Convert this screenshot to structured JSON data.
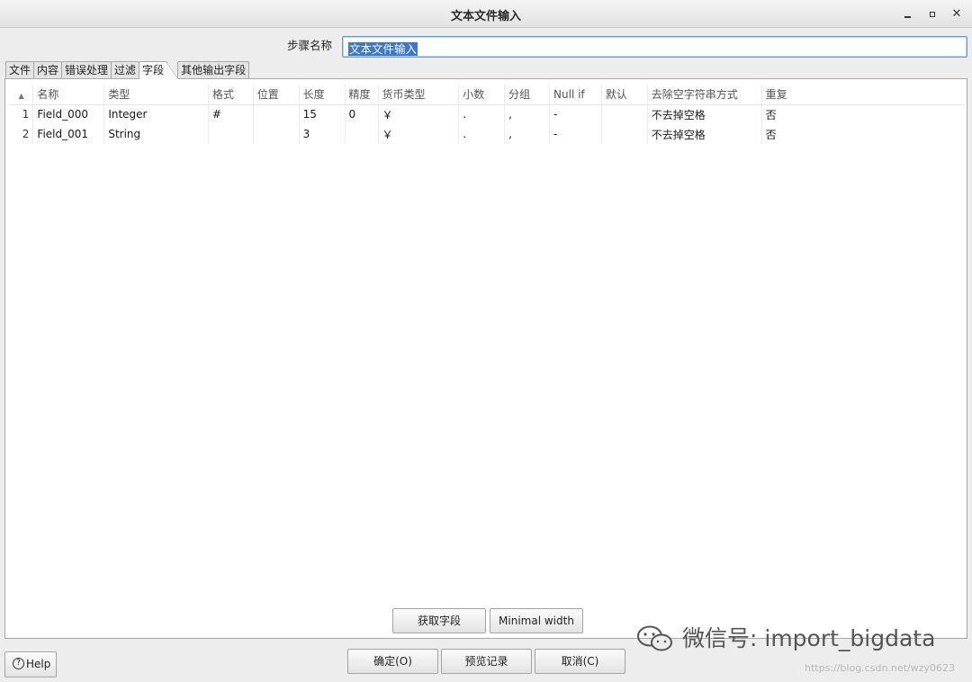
{
  "window": {
    "title": "文本文件输入"
  },
  "step": {
    "label": "步骤名称",
    "value": "文本文件输入"
  },
  "tabs": [
    {
      "label": "文件"
    },
    {
      "label": "内容"
    },
    {
      "label": "错误处理"
    },
    {
      "label": "过滤"
    },
    {
      "label": "字段",
      "active": true
    },
    {
      "label": "其他输出字段"
    }
  ],
  "table": {
    "columns": [
      "名称",
      "类型",
      "格式",
      "位置",
      "长度",
      "精度",
      "货币类型",
      "小数",
      "分组",
      "Null if",
      "默认",
      "去除空字符串方式",
      "重复"
    ],
    "rows": [
      {
        "num": "1",
        "cells": [
          "Field_000",
          "Integer",
          "#",
          "",
          "15",
          "0",
          "￥",
          ".",
          ",",
          "-",
          "",
          "不去掉空格",
          "否"
        ]
      },
      {
        "num": "2",
        "cells": [
          "Field_001",
          "String",
          "",
          "",
          "3",
          "",
          "￥",
          ".",
          ",",
          "-",
          "",
          "不去掉空格",
          "否"
        ]
      }
    ]
  },
  "buttons": {
    "get_fields": "获取字段",
    "minimal_width": "Minimal width",
    "ok": "确定(O)",
    "preview": "预览记录",
    "cancel": "取消(C)",
    "help": "Help"
  },
  "watermark": {
    "wechat": "微信号: import_bigdata",
    "csdn": "https://blog.csdn.net/wzy0623"
  }
}
